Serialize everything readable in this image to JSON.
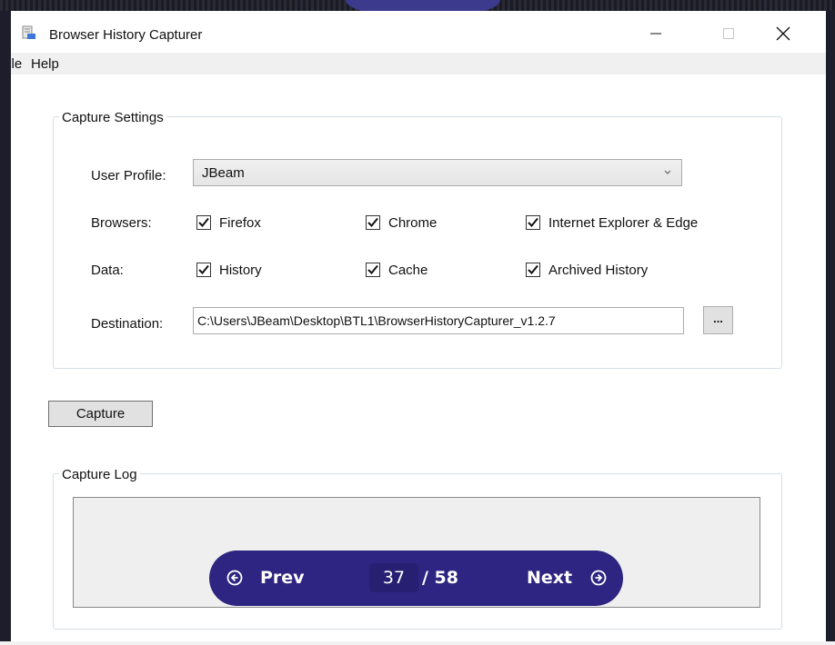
{
  "window": {
    "title": "Browser History Capturer",
    "controls": {
      "minimize": "minimize-icon",
      "maximize": "maximize-icon",
      "close": "close-icon"
    }
  },
  "menu": {
    "items": [
      "File",
      "Help"
    ]
  },
  "capture_settings": {
    "legend": "Capture Settings",
    "user_profile": {
      "label": "User Profile:",
      "value": "JBeam"
    },
    "browsers": {
      "label": "Browsers:",
      "options": [
        {
          "label": "Firefox",
          "checked": true
        },
        {
          "label": "Chrome",
          "checked": true
        },
        {
          "label": "Internet Explorer & Edge",
          "checked": true
        }
      ]
    },
    "data": {
      "label": "Data:",
      "options": [
        {
          "label": "History",
          "checked": true
        },
        {
          "label": "Cache",
          "checked": true
        },
        {
          "label": "Archived History",
          "checked": true
        }
      ]
    },
    "destination": {
      "label": "Destination:",
      "value": "C:\\Users\\JBeam\\Desktop\\BTL1\\BrowserHistoryCapturer_v1.2.7",
      "browse_label": "..."
    }
  },
  "capture_button": {
    "label": "Capture"
  },
  "capture_log": {
    "legend": "Capture Log",
    "content": ""
  },
  "pager": {
    "prev_label": "Prev",
    "current": "37",
    "total": "/ 58",
    "next_label": "Next"
  },
  "colors": {
    "pager_bg": "#2d2581",
    "accent_blue": "#3b78d8"
  }
}
